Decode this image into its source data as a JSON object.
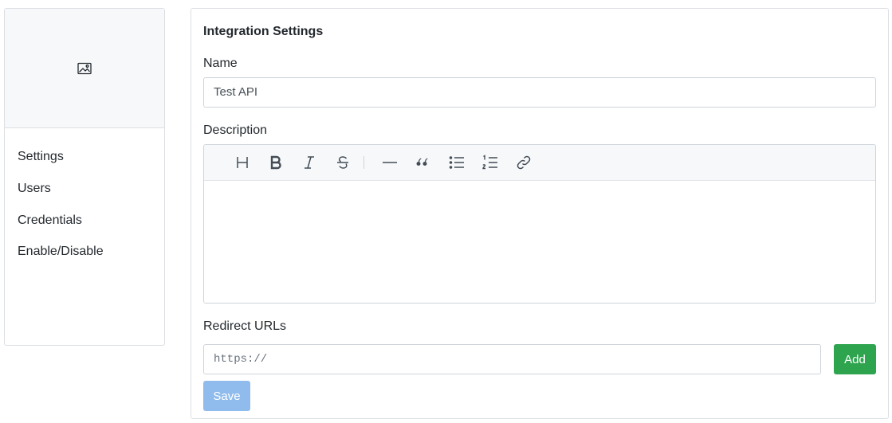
{
  "sidebar": {
    "image_icon": "image-icon",
    "items": [
      {
        "label": "Settings"
      },
      {
        "label": "Users"
      },
      {
        "label": "Credentials"
      },
      {
        "label": "Enable/Disable"
      }
    ]
  },
  "panel": {
    "title": "Integration Settings",
    "name_label": "Name",
    "name_value": "Test API",
    "description_label": "Description",
    "toolbar_icons": [
      "heading-icon",
      "bold-icon",
      "italic-icon",
      "strikethrough-icon",
      "horizontal-rule-icon",
      "quote-icon",
      "bullet-list-icon",
      "numbered-list-icon",
      "link-icon"
    ],
    "redirect_label": "Redirect URLs",
    "redirect_placeholder": "https://",
    "add_label": "Add",
    "save_label": "Save"
  },
  "colors": {
    "add_button": "#2ea44f",
    "save_button_disabled": "#8fbcec",
    "border": "#dcdfe3"
  }
}
